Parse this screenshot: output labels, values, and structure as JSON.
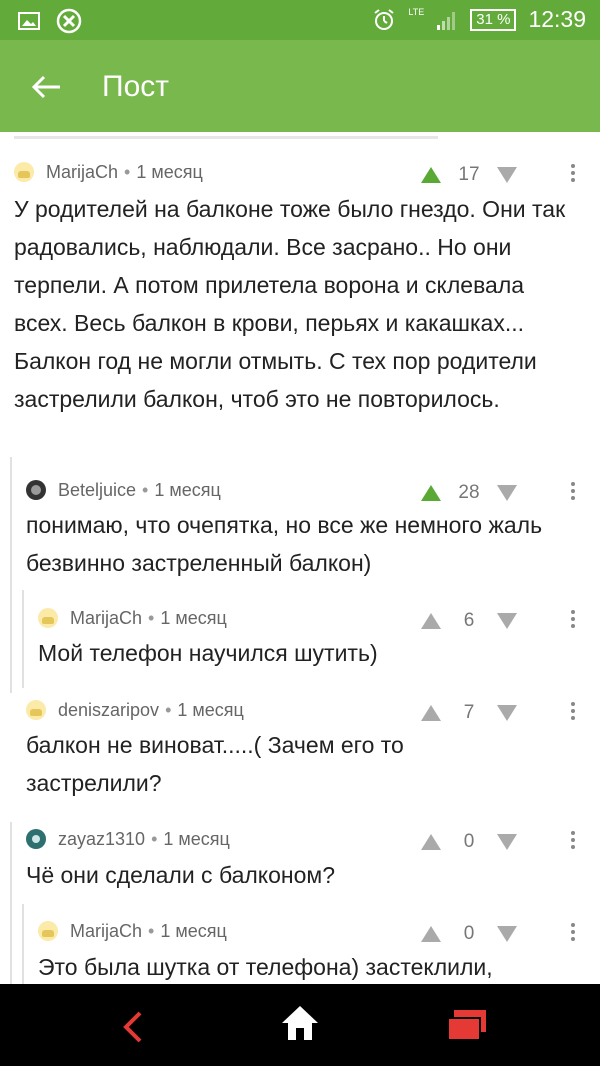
{
  "status": {
    "lte": "LTE",
    "battery": "31 %",
    "time": "12:39"
  },
  "appbar": {
    "title": "Пост"
  },
  "comments": [
    {
      "author": "MarijaCh",
      "time": "1 месяц",
      "votes": "17",
      "upvoted": true,
      "text": "У родителей на балконе тоже было гнездо. Они так радовались, наблюдали. Все засрано.. Но они терпели. А потом прилетела ворона и склевала всех. Весь балкон в крови, перьях и какашках... Балкон год не могли отмыть. С тех пор родители застрелили балкон, чтоб это не повторилось."
    },
    {
      "author": "Beteljuice",
      "time": "1 месяц",
      "votes": "28",
      "upvoted": true,
      "text": "понимаю, что очепятка, но все же немного жаль безвинно застреленный балкон)"
    },
    {
      "author": "MarijaCh",
      "time": "1 месяц",
      "votes": "6",
      "upvoted": false,
      "text": "Мой телефон научился шутить)"
    },
    {
      "author": "deniszaripov",
      "time": "1 месяц",
      "votes": "7",
      "upvoted": false,
      "text": "балкон не виноват.....( Зачем его то застрелили?"
    },
    {
      "author": "zayaz1310",
      "time": "1 месяц",
      "votes": "0",
      "upvoted": false,
      "text": "Чё они сделали с балконом?"
    },
    {
      "author": "MarijaCh",
      "time": "1 месяц",
      "votes": "0",
      "upvoted": false,
      "text": "Это была шутка от телефона) застеклили,"
    }
  ],
  "colors": {
    "statusbar": "#62ab3a",
    "appbar": "#78b84d",
    "upvote_active": "#5aa935",
    "vote_inactive": "#aaaaaa",
    "nav_back": "#e53935",
    "nav_recent": "#e53935"
  },
  "icons": {
    "back": "arrow-left-icon",
    "nav_back": "chevron-left-icon",
    "nav_home": "home-icon",
    "nav_recent": "recent-apps-icon"
  }
}
